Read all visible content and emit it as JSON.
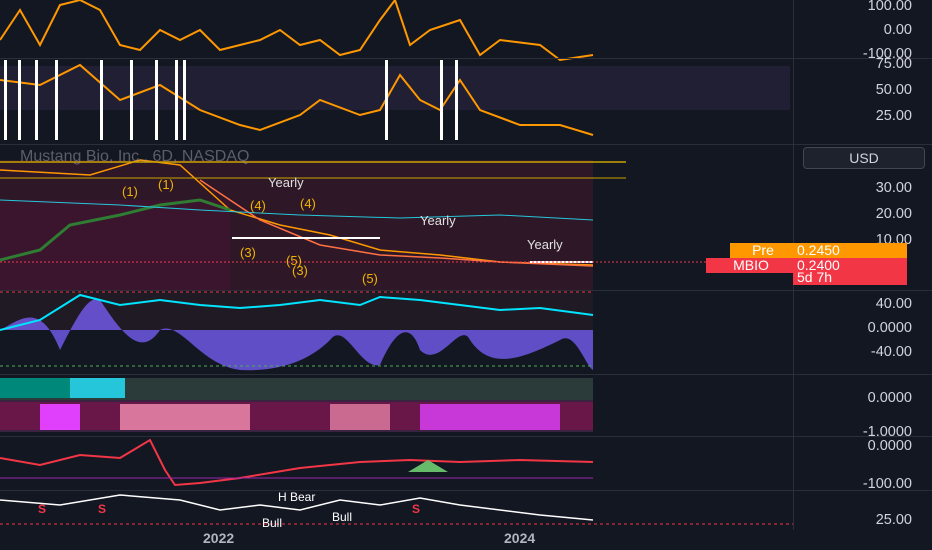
{
  "legend": {
    "symbol_title": "Mustang Bio, Inc., 6D, NASDAQ"
  },
  "currency": "USD",
  "price_tags": {
    "pre_label": "Pre",
    "pre_value": "0.2450",
    "symbol_label": "MBIO",
    "symbol_value": "0.2400",
    "countdown": "5d 7h"
  },
  "axis_labels": {
    "osc1_top": "100.00",
    "osc1_mid": "0.00",
    "osc1_bot": "-100.00",
    "mini_75": "75.00",
    "mini_50": "50.00",
    "mini_25": "25.00",
    "main_30": "30.00",
    "main_20": "20.00",
    "main_10": "10.00",
    "osc2_40": "40.00",
    "osc2_0": "0.0000",
    "osc2_m40": "-40.00",
    "osc3_0": "0.0000",
    "osc3_m1": "-1.0000",
    "osc4_0": "0.0000",
    "osc4_m100": "-100.00",
    "osc5_25": "25.00"
  },
  "time_axis": {
    "label_2022": "2022",
    "label_2024": "2024"
  },
  "annotations": {
    "wave_1a": "(1)",
    "wave_1b": "(1)",
    "wave_4a": "(4)",
    "wave_4b": "(4)",
    "wave_3a": "(3)",
    "wave_5a": "(5)",
    "wave_3b": "(3)",
    "wave_5b": "(5)",
    "yearly_1": "Yearly",
    "yearly_2": "Yearly",
    "yearly_3": "Yearly"
  },
  "signals": {
    "s1": "S",
    "s2": "S",
    "s3": "S",
    "bull_1": "Bull",
    "bull_2": "Bull",
    "bear_1": "H Bear"
  },
  "colors": {
    "background": "#131722",
    "orange": "#ff9800",
    "red": "#f23645",
    "green": "#22ab94",
    "purple": "#7b61ff",
    "magenta": "#e040fb"
  }
}
